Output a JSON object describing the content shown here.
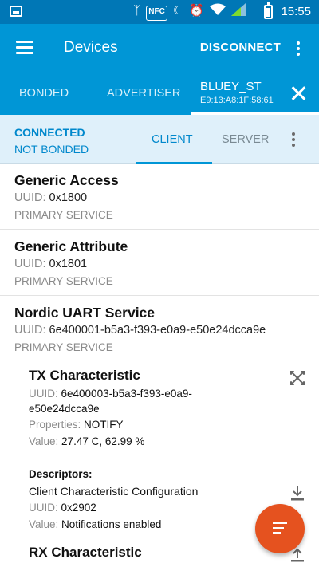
{
  "status_bar": {
    "time": "15:55",
    "icons": [
      "image-notification-icon",
      "bluetooth-icon",
      "nfc-icon",
      "moon-icon",
      "alarm-icon",
      "wifi-icon",
      "signal-icon",
      "battery-icon"
    ],
    "nfc_label": "NFC"
  },
  "toolbar": {
    "title": "Devices",
    "disconnect_label": "DISCONNECT"
  },
  "device_tabs": {
    "bonded": "BONDED",
    "advertiser": "ADVERTISER",
    "device_name": "BLUEY_ST",
    "device_address": "E9:13:A8:1F:58:61"
  },
  "connection": {
    "state": "CONNECTED",
    "bond_state": "NOT BONDED",
    "tab_client": "CLIENT",
    "tab_server": "SERVER"
  },
  "labels": {
    "uuid": "UUID:",
    "properties": "Properties:",
    "value": "Value:",
    "descriptors": "Descriptors:"
  },
  "services": [
    {
      "name": "Generic Access",
      "uuid": "0x1800",
      "type": "PRIMARY SERVICE"
    },
    {
      "name": "Generic Attribute",
      "uuid": "0x1801",
      "type": "PRIMARY SERVICE"
    },
    {
      "name": "Nordic UART Service",
      "uuid": "6e400001-b5a3-f393-e0a9-e50e24dcca9e",
      "type": "PRIMARY SERVICE"
    }
  ],
  "tx_characteristic": {
    "name": "TX Characteristic",
    "uuid_line1": "6e400003-b5a3-f393-e0a9-",
    "uuid_line2": "e50e24dcca9e",
    "properties": "NOTIFY",
    "value": "27.47 C, 62.99 %"
  },
  "descriptor": {
    "name": "Client Characteristic Configuration",
    "uuid": "0x2902",
    "value": "Notifications enabled"
  },
  "rx_characteristic": {
    "name": "RX Characteristic"
  },
  "colors": {
    "status_bar": "#0077b6",
    "app_bar": "#0096d6",
    "accent": "#0088cc",
    "fab": "#e5521f",
    "connection_bar": "#dff0fa"
  }
}
